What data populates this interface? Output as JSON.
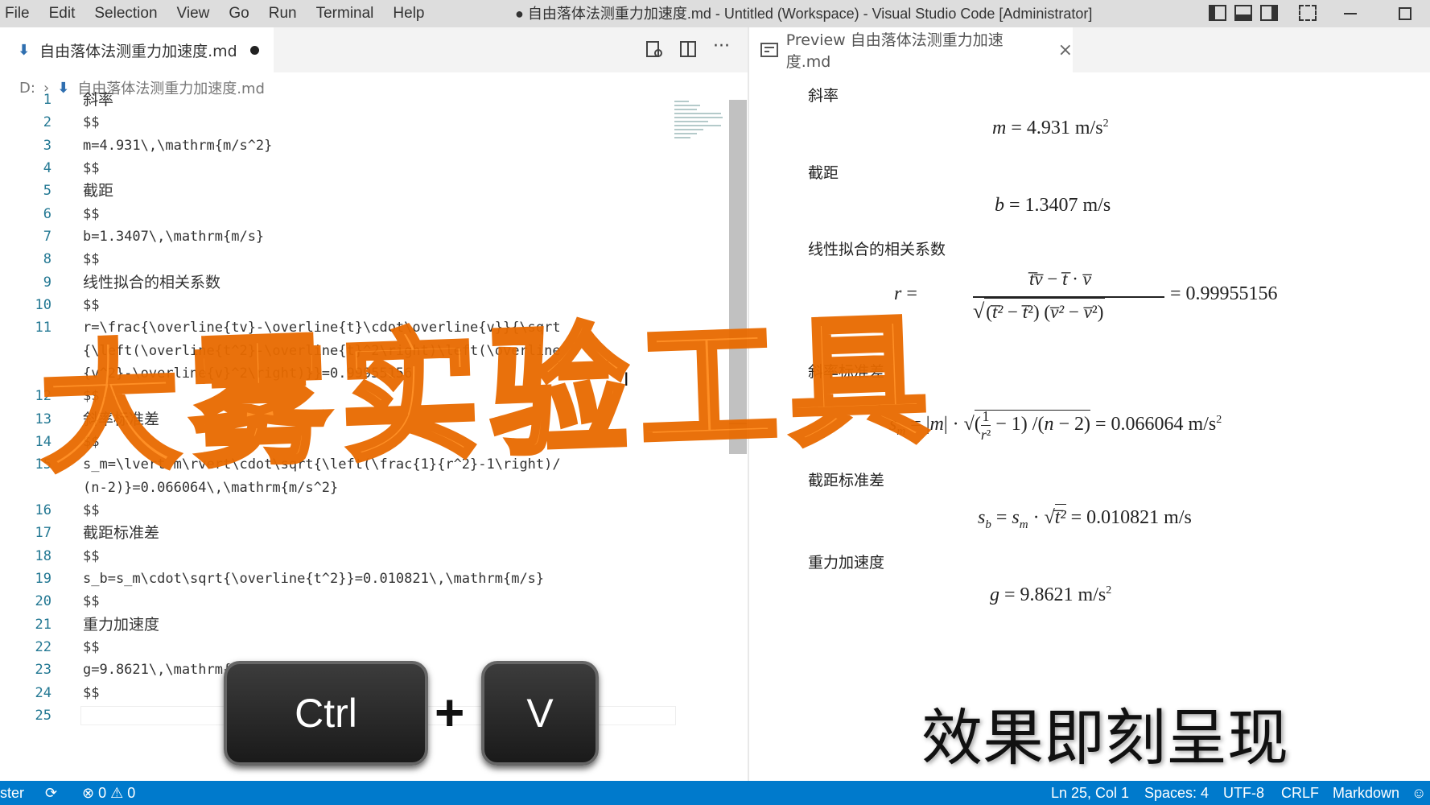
{
  "titlebar": {
    "menu": [
      "File",
      "Edit",
      "Selection",
      "View",
      "Go",
      "Run",
      "Terminal",
      "Help"
    ],
    "title": "● 自由落体法测重力加速度.md - Untitled (Workspace) - Visual Studio Code [Administrator]"
  },
  "editor": {
    "tab_label": "自由落体法测重力加速度.md",
    "breadcrumb": {
      "drive": "D:",
      "file": "自由落体法测重力加速度.md"
    },
    "lines": [
      {
        "n": "1",
        "t": "斜率",
        "cn": true
      },
      {
        "n": "2",
        "t": "$$"
      },
      {
        "n": "3",
        "t": "m=4.931\\,\\mathrm{m/s^2}"
      },
      {
        "n": "4",
        "t": "$$"
      },
      {
        "n": "5",
        "t": "截距",
        "cn": true
      },
      {
        "n": "6",
        "t": "$$"
      },
      {
        "n": "7",
        "t": "b=1.3407\\,\\mathrm{m/s}"
      },
      {
        "n": "8",
        "t": "$$"
      },
      {
        "n": "9",
        "t": "线性拟合的相关系数",
        "cn": true
      },
      {
        "n": "10",
        "t": "$$"
      },
      {
        "n": "11",
        "t": "r=\\frac{\\overline{tv}-\\overline{t}\\cdot\\overline{v}}{\\sqrt"
      },
      {
        "n": "",
        "t": "{\\left(\\overline{t^2}-\\overline{t}^2\\right)\\left(\\overline"
      },
      {
        "n": "",
        "t": "{v^2}-\\overline{v}^2\\right)}}=0.99955156"
      },
      {
        "n": "12",
        "t": "$$"
      },
      {
        "n": "13",
        "t": "斜率标准差",
        "cn": true
      },
      {
        "n": "14",
        "t": "$$"
      },
      {
        "n": "15",
        "t": "s_m=\\lvert m\\rvert\\cdot\\sqrt{\\left(\\frac{1}{r^2}-1\\right)/"
      },
      {
        "n": "",
        "t": "(n-2)}=0.066064\\,\\mathrm{m/s^2}"
      },
      {
        "n": "16",
        "t": "$$"
      },
      {
        "n": "17",
        "t": "截距标准差",
        "cn": true
      },
      {
        "n": "18",
        "t": "$$"
      },
      {
        "n": "19",
        "t": "s_b=s_m\\cdot\\sqrt{\\overline{t^2}}=0.010821\\,\\mathrm{m/s}"
      },
      {
        "n": "20",
        "t": "$$"
      },
      {
        "n": "21",
        "t": "重力加速度",
        "cn": true
      },
      {
        "n": "22",
        "t": "$$"
      },
      {
        "n": "23",
        "t": "g=9.8621\\,\\mathrm{m/s^2}"
      },
      {
        "n": "24",
        "t": "$$"
      },
      {
        "n": "25",
        "t": ""
      }
    ]
  },
  "preview": {
    "tab_label": "Preview 自由落体法测重力加速度.md",
    "headings": {
      "slope": "斜率",
      "intercept": "截距",
      "corr": "线性拟合的相关系数",
      "slope_sd": "斜率标准差",
      "intercept_sd": "截距标准差",
      "gravity": "重力加速度"
    },
    "values": {
      "m": "4.931",
      "b": "1.3407",
      "r": "0.99955156",
      "sm": "0.066064",
      "sb": "0.010821",
      "g": "9.8621"
    },
    "units": {
      "ms2": "m/s",
      "ms": "m/s"
    }
  },
  "overlay": {
    "watermark": "大雾实验工具",
    "key1": "Ctrl",
    "plus": "+",
    "key2": "V",
    "caption": "效果即刻呈现"
  },
  "statusbar": {
    "branch": "ster",
    "errors": "0",
    "warnings": "0",
    "position": "Ln 25, Col 1",
    "spaces": "Spaces: 4",
    "encoding": "UTF-8",
    "eol": "CRLF",
    "language": "Markdown"
  },
  "colors": {
    "statusbar": "#007acc",
    "watermark": "#ff8a1a",
    "linenumber": "#237893"
  }
}
